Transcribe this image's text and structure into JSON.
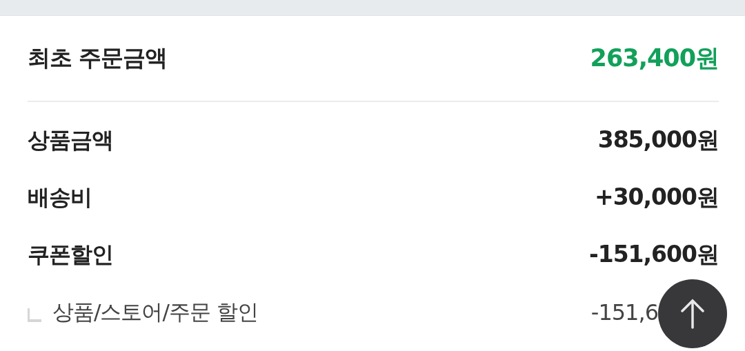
{
  "summary": {
    "title": "최초 주문금액",
    "total": "263,400원"
  },
  "rows": [
    {
      "kind": "main",
      "label": "상품금액",
      "value": "385,000원"
    },
    {
      "kind": "main",
      "label": "배송비",
      "value": "+30,000원"
    },
    {
      "kind": "main",
      "label": "쿠폰할인",
      "value": "-151,600원"
    },
    {
      "kind": "sub",
      "label": "상품/스토어/주문 할인",
      "value": "-151,6"
    }
  ]
}
